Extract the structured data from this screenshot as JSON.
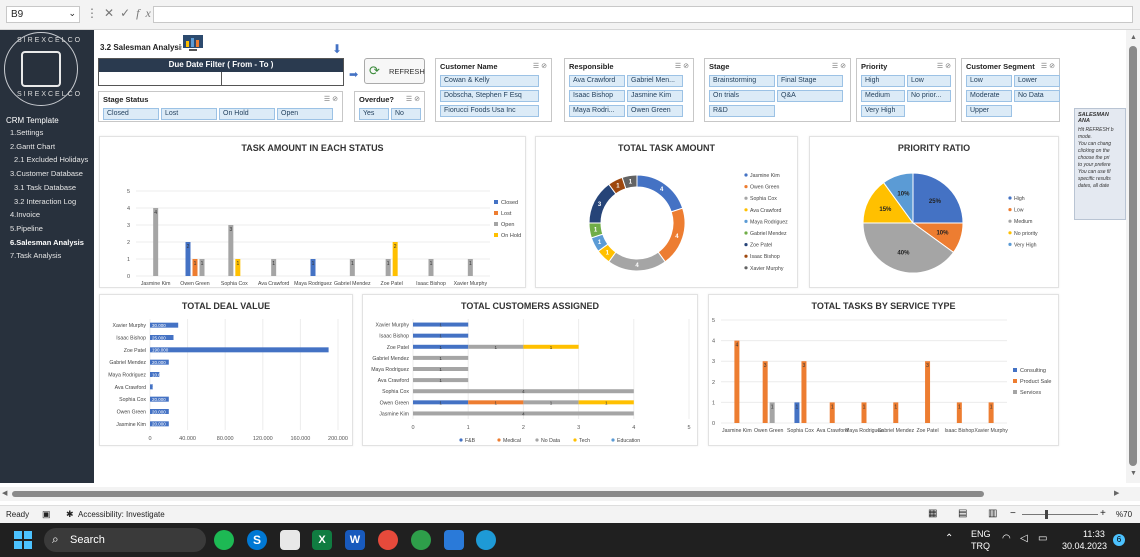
{
  "formula": {
    "namebox": "B9",
    "fx": "fx"
  },
  "nav": {
    "title": "CRM Template",
    "items": [
      {
        "label": "1.Settings",
        "sub": false
      },
      {
        "label": "2.Gantt Chart",
        "sub": false
      },
      {
        "label": "2.1 Excluded Holidays",
        "sub": true
      },
      {
        "label": "3.Customer Database",
        "sub": false
      },
      {
        "label": "3.1 Task Database",
        "sub": true
      },
      {
        "label": "3.2 Interaction Log",
        "sub": true
      },
      {
        "label": "4.Invoice",
        "sub": false
      },
      {
        "label": "5.Pipeline",
        "sub": false
      },
      {
        "label": "6.Salesman Analysis",
        "sub": false,
        "active": true
      },
      {
        "label": "7.Task Analysis",
        "sub": false
      }
    ]
  },
  "logo": {
    "text_top": "SIREXCELCO",
    "text_bottom": "SIREXCELCO"
  },
  "header": {
    "title": "3.2 Salesman Analysis",
    "filter_title": "Due Date Filter ( From - To )",
    "refresh": "REFRESH"
  },
  "slicers": {
    "stage_status": {
      "title": "Stage Status",
      "items": [
        "Closed",
        "Lost",
        "On Hold",
        "Open"
      ]
    },
    "overdue": {
      "title": "Overdue?",
      "items": [
        "Yes",
        "No"
      ]
    },
    "customer_name": {
      "title": "Customer Name",
      "items": [
        "Cowan & Kelly",
        "Dobscha, Stephen F Esq",
        "Fiorucci Foods Usa Inc"
      ]
    },
    "responsible": {
      "title": "Responsible",
      "items": [
        "Ava Crawford",
        "Gabriel Men...",
        "Isaac Bishop",
        "Jasmine Kim",
        "Maya Rodri...",
        "Owen Green"
      ]
    },
    "stage": {
      "title": "Stage",
      "items": [
        "Brainstorming",
        "Final Stage",
        "On trials",
        "Q&A",
        "R&D"
      ]
    },
    "priority": {
      "title": "Priority",
      "items": [
        "High",
        "Low",
        "Medium",
        "No prior...",
        "Very High"
      ]
    },
    "segment": {
      "title": "Customer Segment",
      "items": [
        "Low",
        "Lower",
        "Moderate",
        "No Data",
        "Upper"
      ]
    }
  },
  "notes": {
    "title": "SALESMAN ANA",
    "lines": [
      "Hit REFRESH b",
      "mode.",
      "You can chang",
      "clicking on the",
      "choose the pri",
      "to your prefere",
      "You can use fil",
      "specific results",
      "dates, all date"
    ]
  },
  "status": {
    "ready": "Ready",
    "accessibility": "Accessibility: Investigate",
    "zoom": "%70"
  },
  "taskbar": {
    "search": "Search",
    "lang1": "ENG",
    "lang2": "TRQ",
    "time": "11:33",
    "date": "30.04.2023",
    "badge": "6"
  },
  "colors": {
    "blue": "#4472c4",
    "orange": "#ed7d31",
    "gray": "#a5a5a5",
    "yellow": "#ffc000",
    "green": "#70ad47",
    "lightblue": "#5b9bd5",
    "navy": "#264478",
    "brown": "#9e480e",
    "darkgray": "#636363"
  },
  "chart_data": [
    {
      "id": "status",
      "type": "bar",
      "title": "TASK AMOUNT IN EACH STATUS",
      "categories": [
        "Jasmine Kim",
        "Owen Green",
        "Sophia Cox",
        "Ava Crawford",
        "Maya Rodriguez",
        "Gabriel Mendez",
        "Zoe Patel",
        "Isaac Bishop",
        "Xavier Murphy"
      ],
      "ylim": [
        0,
        5
      ],
      "yticks": [
        0,
        1,
        2,
        3,
        4,
        5
      ],
      "series": [
        {
          "name": "Closed",
          "color": "#4472c4",
          "values": [
            0,
            2,
            0,
            0,
            1,
            0,
            0,
            0,
            0
          ]
        },
        {
          "name": "Lost",
          "color": "#ed7d31",
          "values": [
            0,
            1,
            0,
            0,
            0,
            0,
            0,
            0,
            0
          ]
        },
        {
          "name": "Open",
          "color": "#a5a5a5",
          "values": [
            4,
            1,
            3,
            1,
            0,
            1,
            1,
            1,
            1
          ]
        },
        {
          "name": "On Hold",
          "color": "#ffc000",
          "values": [
            0,
            0,
            1,
            0,
            0,
            0,
            2,
            0,
            0
          ]
        }
      ]
    },
    {
      "id": "total",
      "type": "pie",
      "title": "TOTAL TASK AMOUNT",
      "labels": [
        "Jasmine Kim",
        "Owen Green",
        "Sophia Cox",
        "Ava Crawford",
        "Maya Rodriguez",
        "Gabriel Mendez",
        "Zoe Patel",
        "Isaac Bishop",
        "Xavier Murphy"
      ],
      "values": [
        4,
        4,
        4,
        1,
        1,
        1,
        3,
        1,
        1
      ],
      "colors": [
        "#4472c4",
        "#ed7d31",
        "#a5a5a5",
        "#ffc000",
        "#5b9bd5",
        "#70ad47",
        "#264478",
        "#9e480e",
        "#636363"
      ],
      "donut": true
    },
    {
      "id": "priority",
      "type": "pie",
      "title": "PRIORITY RATIO",
      "labels": [
        "High",
        "Low",
        "Medium",
        "No priority",
        "Very High"
      ],
      "values": [
        25,
        10,
        40,
        15,
        10
      ],
      "display": [
        "25%",
        "10%",
        "40%",
        "15%",
        "10%"
      ],
      "colors": [
        "#4472c4",
        "#ed7d31",
        "#a5a5a5",
        "#ffc000",
        "#5b9bd5"
      ]
    },
    {
      "id": "deal",
      "type": "bar",
      "orientation": "horizontal",
      "title": "TOTAL DEAL VALUE",
      "categories": [
        "Xavier Murphy",
        "Isaac Bishop",
        "Zoe Patel",
        "Gabriel Mendez",
        "Maya Rodriguez",
        "Ava Crawford",
        "Sophia Cox",
        "Owen Green",
        "Jasmine Kim"
      ],
      "values": [
        30000,
        25000,
        190000,
        20000,
        10000,
        3000,
        20000,
        20000,
        20000
      ],
      "labels": [
        "30.000",
        "25.000",
        "190.000",
        "20.000",
        "10.000",
        "3.000",
        "20.000",
        "20.000",
        "20.000"
      ],
      "xlim": [
        0,
        200000
      ],
      "xticks": [
        "0",
        "40.000",
        "80.000",
        "120.000",
        "160.000",
        "200.000"
      ],
      "color": "#4472c4"
    },
    {
      "id": "customers",
      "type": "bar",
      "orientation": "horizontal",
      "stacked": true,
      "title": "TOTAL CUSTOMERS ASSIGNED",
      "categories": [
        "Xavier Murphy",
        "Isaac Bishop",
        "Zoe Patel",
        "Gabriel Mendez",
        "Maya Rodriguez",
        "Ava Crawford",
        "Sophia Cox",
        "Owen Green",
        "Jasmine Kim"
      ],
      "xlim": [
        0,
        5
      ],
      "xticks": [
        "0",
        "1",
        "2",
        "3",
        "4",
        "5"
      ],
      "series": [
        {
          "name": "F&B",
          "color": "#4472c4",
          "values": [
            1,
            1,
            1,
            0,
            0,
            0,
            0,
            1,
            0
          ]
        },
        {
          "name": "Medical",
          "color": "#ed7d31",
          "values": [
            0,
            0,
            0,
            0,
            0,
            0,
            0,
            1,
            0
          ]
        },
        {
          "name": "No Data",
          "color": "#a5a5a5",
          "values": [
            0,
            0,
            1,
            1,
            1,
            1,
            4,
            1,
            4
          ]
        },
        {
          "name": "Tech",
          "color": "#ffc000",
          "values": [
            0,
            0,
            1,
            0,
            0,
            0,
            0,
            1,
            0
          ]
        },
        {
          "name": "Education",
          "color": "#5b9bd5",
          "values": [
            0,
            0,
            0,
            0,
            0,
            0,
            0,
            0,
            0
          ]
        }
      ]
    },
    {
      "id": "service",
      "type": "bar",
      "title": "TOTAL TASKS BY SERVICE TYPE",
      "categories": [
        "Jasmine Kim",
        "Owen Green",
        "Sophia Cox",
        "Ava Crawford",
        "Maya Rodriguez",
        "Gabriel Mendez",
        "Zoe Patel",
        "Isaac Bishop",
        "Xavier Murphy"
      ],
      "ylim": [
        0,
        5
      ],
      "yticks": [
        0,
        1,
        2,
        3,
        4,
        5
      ],
      "series": [
        {
          "name": "Consulting",
          "color": "#4472c4",
          "values": [
            0,
            0,
            1,
            0,
            0,
            0,
            0,
            0,
            0
          ]
        },
        {
          "name": "Product Sale",
          "color": "#ed7d31",
          "values": [
            4,
            3,
            3,
            1,
            1,
            1,
            3,
            1,
            1
          ]
        },
        {
          "name": "Services",
          "color": "#a5a5a5",
          "values": [
            0,
            1,
            0,
            0,
            0,
            0,
            0,
            0,
            0
          ]
        }
      ]
    }
  ]
}
